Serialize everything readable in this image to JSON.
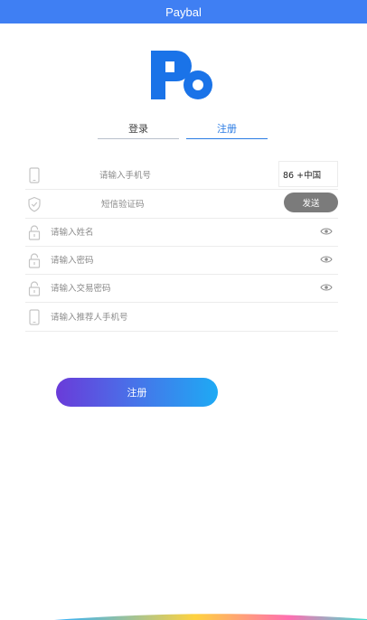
{
  "app": {
    "title": "Paybal"
  },
  "tabs": {
    "login": "登录",
    "register": "注册"
  },
  "form": {
    "phone_placeholder": "请输入手机号",
    "country_code": "86 +中国",
    "sms_placeholder": "短信验证码",
    "send_label": "发送",
    "name_placeholder": "请输入姓名",
    "password_placeholder": "请输入密码",
    "trade_password_placeholder": "请输入交易密码",
    "referrer_placeholder": "请输入推荐人手机号"
  },
  "submit_label": "注册",
  "colors": {
    "header": "#3f7ff3",
    "accent": "#2a7be4",
    "logo": "#1a73e8",
    "send": "#7b7b7b"
  }
}
